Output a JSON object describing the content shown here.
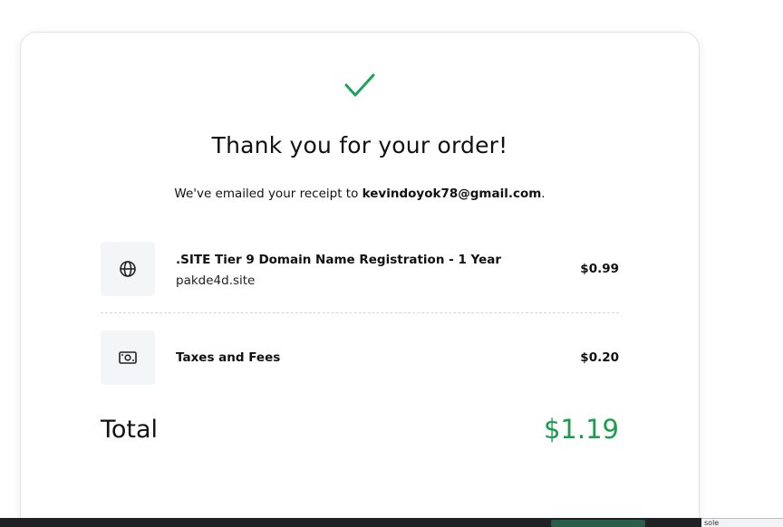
{
  "confirmation": {
    "title": "Thank you for your order!",
    "email_prefix": "We've emailed your receipt to ",
    "email": "kevindoyok78@gmail.com",
    "email_suffix": "."
  },
  "items": [
    {
      "icon": "globe-icon",
      "title": ".SITE Tier 9 Domain Name Registration - 1 Year",
      "subtitle": "pakde4d.site",
      "price": "$0.99"
    },
    {
      "icon": "money-icon",
      "title": "Taxes and Fees",
      "price": "$0.20"
    }
  ],
  "total": {
    "label": "Total",
    "value": "$1.19"
  },
  "devtools": {
    "tab_label": "sole"
  },
  "colors": {
    "accent_green": "#1a9e4e",
    "check_green": "#1aa35a"
  }
}
